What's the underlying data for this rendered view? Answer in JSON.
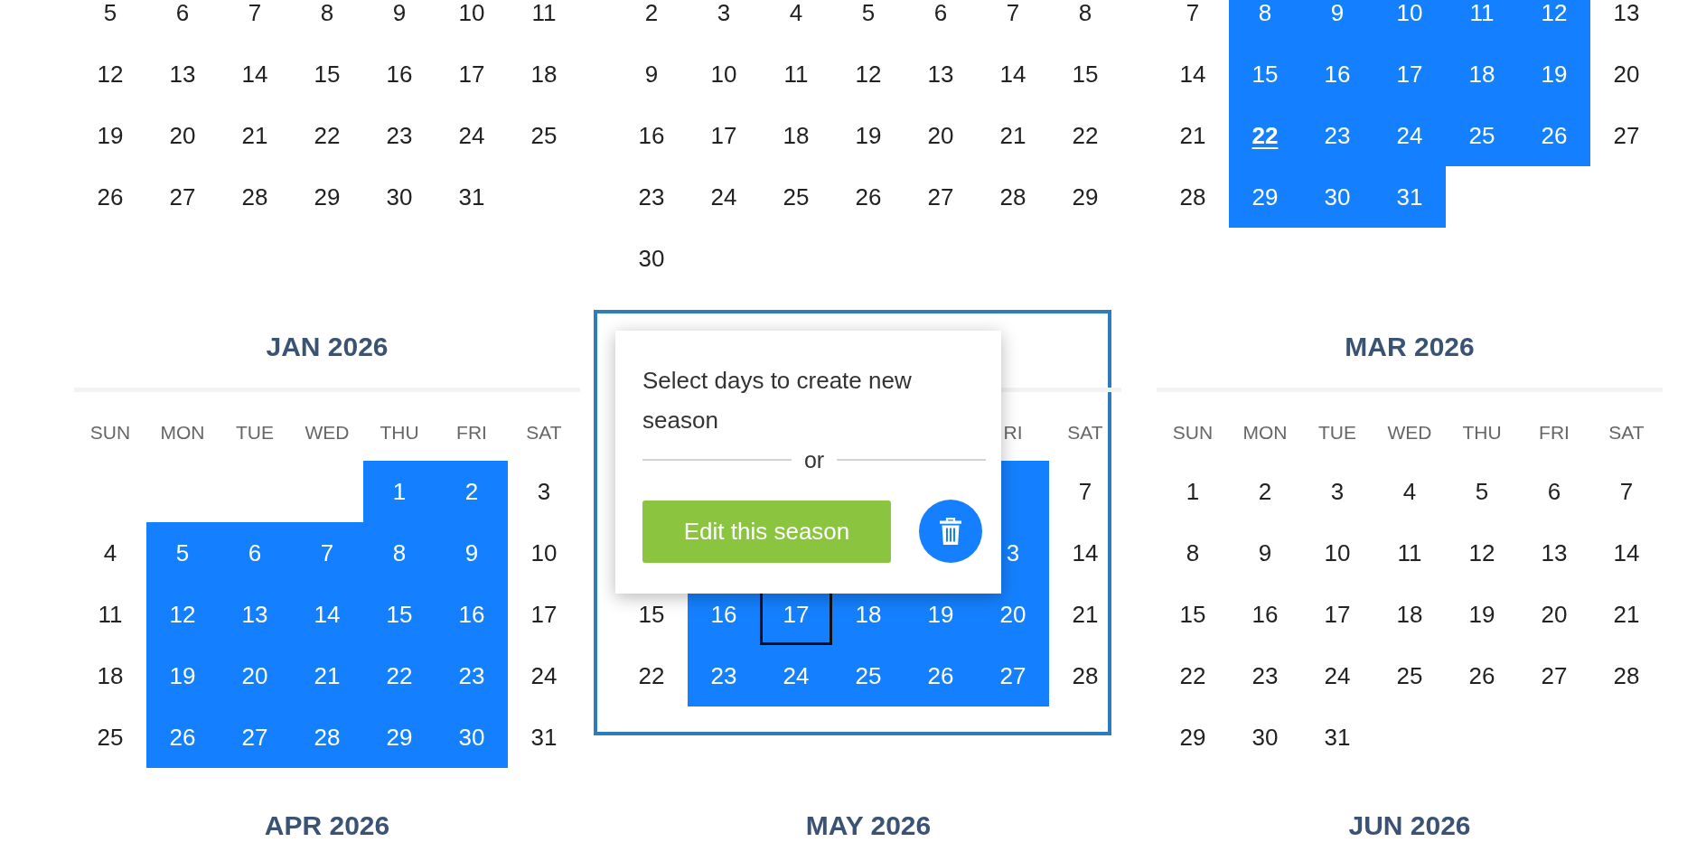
{
  "rows": [
    {
      "months": [
        {
          "highlighted": false,
          "weeks": [
            [
              {
                "day": "5",
                "selected": false,
                "today": false,
                "focused": false
              },
              {
                "day": "6",
                "selected": false,
                "today": false,
                "focused": false
              },
              {
                "day": "7",
                "selected": false,
                "today": false,
                "focused": false
              },
              {
                "day": "8",
                "selected": false,
                "today": false,
                "focused": false
              },
              {
                "day": "9",
                "selected": false,
                "today": false,
                "focused": false
              },
              {
                "day": "10",
                "selected": false,
                "today": false,
                "focused": false
              },
              {
                "day": "11",
                "selected": false,
                "today": false,
                "focused": false
              }
            ],
            [
              {
                "day": "12",
                "selected": false,
                "today": false,
                "focused": false
              },
              {
                "day": "13",
                "selected": false,
                "today": false,
                "focused": false
              },
              {
                "day": "14",
                "selected": false,
                "today": false,
                "focused": false
              },
              {
                "day": "15",
                "selected": false,
                "today": false,
                "focused": false
              },
              {
                "day": "16",
                "selected": false,
                "today": false,
                "focused": false
              },
              {
                "day": "17",
                "selected": false,
                "today": false,
                "focused": false
              },
              {
                "day": "18",
                "selected": false,
                "today": false,
                "focused": false
              }
            ],
            [
              {
                "day": "19",
                "selected": false,
                "today": false,
                "focused": false
              },
              {
                "day": "20",
                "selected": false,
                "today": false,
                "focused": false
              },
              {
                "day": "21",
                "selected": false,
                "today": false,
                "focused": false
              },
              {
                "day": "22",
                "selected": false,
                "today": false,
                "focused": false
              },
              {
                "day": "23",
                "selected": false,
                "today": false,
                "focused": false
              },
              {
                "day": "24",
                "selected": false,
                "today": false,
                "focused": false
              },
              {
                "day": "25",
                "selected": false,
                "today": false,
                "focused": false
              }
            ],
            [
              {
                "day": "26",
                "selected": false,
                "today": false,
                "focused": false
              },
              {
                "day": "27",
                "selected": false,
                "today": false,
                "focused": false
              },
              {
                "day": "28",
                "selected": false,
                "today": false,
                "focused": false
              },
              {
                "day": "29",
                "selected": false,
                "today": false,
                "focused": false
              },
              {
                "day": "30",
                "selected": false,
                "today": false,
                "focused": false
              },
              {
                "day": "31",
                "selected": false,
                "today": false,
                "focused": false
              }
            ]
          ]
        },
        {
          "highlighted": false,
          "weeks": [
            [
              {
                "day": "2",
                "selected": false,
                "today": false,
                "focused": false
              },
              {
                "day": "3",
                "selected": false,
                "today": false,
                "focused": false
              },
              {
                "day": "4",
                "selected": false,
                "today": false,
                "focused": false
              },
              {
                "day": "5",
                "selected": false,
                "today": false,
                "focused": false
              },
              {
                "day": "6",
                "selected": false,
                "today": false,
                "focused": false
              },
              {
                "day": "7",
                "selected": false,
                "today": false,
                "focused": false
              },
              {
                "day": "8",
                "selected": false,
                "today": false,
                "focused": false
              }
            ],
            [
              {
                "day": "9",
                "selected": false,
                "today": false,
                "focused": false
              },
              {
                "day": "10",
                "selected": false,
                "today": false,
                "focused": false
              },
              {
                "day": "11",
                "selected": false,
                "today": false,
                "focused": false
              },
              {
                "day": "12",
                "selected": false,
                "today": false,
                "focused": false
              },
              {
                "day": "13",
                "selected": false,
                "today": false,
                "focused": false
              },
              {
                "day": "14",
                "selected": false,
                "today": false,
                "focused": false
              },
              {
                "day": "15",
                "selected": false,
                "today": false,
                "focused": false
              }
            ],
            [
              {
                "day": "16",
                "selected": false,
                "today": false,
                "focused": false
              },
              {
                "day": "17",
                "selected": false,
                "today": false,
                "focused": false
              },
              {
                "day": "18",
                "selected": false,
                "today": false,
                "focused": false
              },
              {
                "day": "19",
                "selected": false,
                "today": false,
                "focused": false
              },
              {
                "day": "20",
                "selected": false,
                "today": false,
                "focused": false
              },
              {
                "day": "21",
                "selected": false,
                "today": false,
                "focused": false
              },
              {
                "day": "22",
                "selected": false,
                "today": false,
                "focused": false
              }
            ],
            [
              {
                "day": "23",
                "selected": false,
                "today": false,
                "focused": false
              },
              {
                "day": "24",
                "selected": false,
                "today": false,
                "focused": false
              },
              {
                "day": "25",
                "selected": false,
                "today": false,
                "focused": false
              },
              {
                "day": "26",
                "selected": false,
                "today": false,
                "focused": false
              },
              {
                "day": "27",
                "selected": false,
                "today": false,
                "focused": false
              },
              {
                "day": "28",
                "selected": false,
                "today": false,
                "focused": false
              },
              {
                "day": "29",
                "selected": false,
                "today": false,
                "focused": false
              }
            ],
            [
              {
                "day": "30",
                "selected": false,
                "today": false,
                "focused": false
              }
            ]
          ]
        },
        {
          "highlighted": false,
          "weeks": [
            [
              {
                "day": "7",
                "selected": false,
                "today": false,
                "focused": false
              },
              {
                "day": "8",
                "selected": true,
                "today": false,
                "focused": false
              },
              {
                "day": "9",
                "selected": true,
                "today": false,
                "focused": false
              },
              {
                "day": "10",
                "selected": true,
                "today": false,
                "focused": false
              },
              {
                "day": "11",
                "selected": true,
                "today": false,
                "focused": false
              },
              {
                "day": "12",
                "selected": true,
                "today": false,
                "focused": false
              },
              {
                "day": "13",
                "selected": false,
                "today": false,
                "focused": false
              }
            ],
            [
              {
                "day": "14",
                "selected": false,
                "today": false,
                "focused": false
              },
              {
                "day": "15",
                "selected": true,
                "today": false,
                "focused": false
              },
              {
                "day": "16",
                "selected": true,
                "today": false,
                "focused": false
              },
              {
                "day": "17",
                "selected": true,
                "today": false,
                "focused": false
              },
              {
                "day": "18",
                "selected": true,
                "today": false,
                "focused": false
              },
              {
                "day": "19",
                "selected": true,
                "today": false,
                "focused": false
              },
              {
                "day": "20",
                "selected": false,
                "today": false,
                "focused": false
              }
            ],
            [
              {
                "day": "21",
                "selected": false,
                "today": false,
                "focused": false
              },
              {
                "day": "22",
                "selected": true,
                "today": true,
                "focused": false
              },
              {
                "day": "23",
                "selected": true,
                "today": false,
                "focused": false
              },
              {
                "day": "24",
                "selected": true,
                "today": false,
                "focused": false
              },
              {
                "day": "25",
                "selected": true,
                "today": false,
                "focused": false
              },
              {
                "day": "26",
                "selected": true,
                "today": false,
                "focused": false
              },
              {
                "day": "27",
                "selected": false,
                "today": false,
                "focused": false
              }
            ],
            [
              {
                "day": "28",
                "selected": false,
                "today": false,
                "focused": false
              },
              {
                "day": "29",
                "selected": true,
                "today": false,
                "focused": false
              },
              {
                "day": "30",
                "selected": true,
                "today": false,
                "focused": false
              },
              {
                "day": "31",
                "selected": true,
                "today": false,
                "focused": false
              }
            ]
          ]
        }
      ]
    },
    {
      "months": [
        {
          "title": "JAN 2026",
          "highlighted": false,
          "weekdays": [
            "SUN",
            "MON",
            "TUE",
            "WED",
            "THU",
            "FRI",
            "SAT"
          ],
          "weeks": [
            [
              {
                "day": "1",
                "selected": true,
                "today": false,
                "focused": false
              },
              {
                "day": "2",
                "selected": true,
                "today": false,
                "focused": false
              },
              {
                "day": "3",
                "selected": false,
                "today": false,
                "focused": false
              }
            ],
            [
              {
                "day": "4",
                "selected": false,
                "today": false,
                "focused": false
              },
              {
                "day": "5",
                "selected": true,
                "today": false,
                "focused": false
              },
              {
                "day": "6",
                "selected": true,
                "today": false,
                "focused": false
              },
              {
                "day": "7",
                "selected": true,
                "today": false,
                "focused": false
              },
              {
                "day": "8",
                "selected": true,
                "today": false,
                "focused": false
              },
              {
                "day": "9",
                "selected": true,
                "today": false,
                "focused": false
              },
              {
                "day": "10",
                "selected": false,
                "today": false,
                "focused": false
              }
            ],
            [
              {
                "day": "11",
                "selected": false,
                "today": false,
                "focused": false
              },
              {
                "day": "12",
                "selected": true,
                "today": false,
                "focused": false
              },
              {
                "day": "13",
                "selected": true,
                "today": false,
                "focused": false
              },
              {
                "day": "14",
                "selected": true,
                "today": false,
                "focused": false
              },
              {
                "day": "15",
                "selected": true,
                "today": false,
                "focused": false
              },
              {
                "day": "16",
                "selected": true,
                "today": false,
                "focused": false
              },
              {
                "day": "17",
                "selected": false,
                "today": false,
                "focused": false
              }
            ],
            [
              {
                "day": "18",
                "selected": false,
                "today": false,
                "focused": false
              },
              {
                "day": "19",
                "selected": true,
                "today": false,
                "focused": false
              },
              {
                "day": "20",
                "selected": true,
                "today": false,
                "focused": false
              },
              {
                "day": "21",
                "selected": true,
                "today": false,
                "focused": false
              },
              {
                "day": "22",
                "selected": true,
                "today": false,
                "focused": false
              },
              {
                "day": "23",
                "selected": true,
                "today": false,
                "focused": false
              },
              {
                "day": "24",
                "selected": false,
                "today": false,
                "focused": false
              }
            ],
            [
              {
                "day": "25",
                "selected": false,
                "today": false,
                "focused": false
              },
              {
                "day": "26",
                "selected": true,
                "today": false,
                "focused": false
              },
              {
                "day": "27",
                "selected": true,
                "today": false,
                "focused": false
              },
              {
                "day": "28",
                "selected": true,
                "today": false,
                "focused": false
              },
              {
                "day": "29",
                "selected": true,
                "today": false,
                "focused": false
              },
              {
                "day": "30",
                "selected": true,
                "today": false,
                "focused": false
              },
              {
                "day": "31",
                "selected": false,
                "today": false,
                "focused": false
              }
            ]
          ]
        },
        {
          "highlighted": true,
          "weekdays": [
            "RI",
            "SAT"
          ],
          "weeks": [
            [
              {
                "selected": true,
                "today": false,
                "focused": false
              },
              {
                "day": "7",
                "selected": false,
                "today": false,
                "focused": false
              }
            ],
            [
              {
                "day": "3",
                "selected": true,
                "today": false,
                "focused": false
              },
              {
                "day": "14",
                "selected": false,
                "today": false,
                "focused": false
              }
            ],
            [
              {
                "day": "15",
                "selected": false,
                "today": false,
                "focused": false
              },
              {
                "day": "16",
                "selected": true,
                "today": false,
                "focused": false
              },
              {
                "day": "17",
                "selected": true,
                "today": false,
                "focused": true
              },
              {
                "day": "18",
                "selected": true,
                "today": false,
                "focused": false
              },
              {
                "day": "19",
                "selected": true,
                "today": false,
                "focused": false
              },
              {
                "day": "20",
                "selected": true,
                "today": false,
                "focused": false
              },
              {
                "day": "21",
                "selected": false,
                "today": false,
                "focused": false
              }
            ],
            [
              {
                "day": "22",
                "selected": false,
                "today": false,
                "focused": false
              },
              {
                "day": "23",
                "selected": true,
                "today": false,
                "focused": false
              },
              {
                "day": "24",
                "selected": true,
                "today": false,
                "focused": false
              },
              {
                "day": "25",
                "selected": true,
                "today": false,
                "focused": false
              },
              {
                "day": "26",
                "selected": true,
                "today": false,
                "focused": false
              },
              {
                "day": "27",
                "selected": true,
                "today": false,
                "focused": false
              },
              {
                "day": "28",
                "selected": false,
                "today": false,
                "focused": false
              }
            ]
          ],
          "popup": {
            "message": "Select days to create new season",
            "separator": "or",
            "edit_button": "Edit this season"
          }
        },
        {
          "title": "MAR 2026",
          "highlighted": false,
          "weekdays": [
            "SUN",
            "MON",
            "TUE",
            "WED",
            "THU",
            "FRI",
            "SAT"
          ],
          "weeks": [
            [
              {
                "day": "1",
                "selected": false,
                "today": false,
                "focused": false
              },
              {
                "day": "2",
                "selected": false,
                "today": false,
                "focused": false
              },
              {
                "day": "3",
                "selected": false,
                "today": false,
                "focused": false
              },
              {
                "day": "4",
                "selected": false,
                "today": false,
                "focused": false
              },
              {
                "day": "5",
                "selected": false,
                "today": false,
                "focused": false
              },
              {
                "day": "6",
                "selected": false,
                "today": false,
                "focused": false
              },
              {
                "day": "7",
                "selected": false,
                "today": false,
                "focused": false
              }
            ],
            [
              {
                "day": "8",
                "selected": false,
                "today": false,
                "focused": false
              },
              {
                "day": "9",
                "selected": false,
                "today": false,
                "focused": false
              },
              {
                "day": "10",
                "selected": false,
                "today": false,
                "focused": false
              },
              {
                "day": "11",
                "selected": false,
                "today": false,
                "focused": false
              },
              {
                "day": "12",
                "selected": false,
                "today": false,
                "focused": false
              },
              {
                "day": "13",
                "selected": false,
                "today": false,
                "focused": false
              },
              {
                "day": "14",
                "selected": false,
                "today": false,
                "focused": false
              }
            ],
            [
              {
                "day": "15",
                "selected": false,
                "today": false,
                "focused": false
              },
              {
                "day": "16",
                "selected": false,
                "today": false,
                "focused": false
              },
              {
                "day": "17",
                "selected": false,
                "today": false,
                "focused": false
              },
              {
                "day": "18",
                "selected": false,
                "today": false,
                "focused": false
              },
              {
                "day": "19",
                "selected": false,
                "today": false,
                "focused": false
              },
              {
                "day": "20",
                "selected": false,
                "today": false,
                "focused": false
              },
              {
                "day": "21",
                "selected": false,
                "today": false,
                "focused": false
              }
            ],
            [
              {
                "day": "22",
                "selected": false,
                "today": false,
                "focused": false
              },
              {
                "day": "23",
                "selected": false,
                "today": false,
                "focused": false
              },
              {
                "day": "24",
                "selected": false,
                "today": false,
                "focused": false
              },
              {
                "day": "25",
                "selected": false,
                "today": false,
                "focused": false
              },
              {
                "day": "26",
                "selected": false,
                "today": false,
                "focused": false
              },
              {
                "day": "27",
                "selected": false,
                "today": false,
                "focused": false
              },
              {
                "day": "28",
                "selected": false,
                "today": false,
                "focused": false
              }
            ],
            [
              {
                "day": "29",
                "selected": false,
                "today": false,
                "focused": false
              },
              {
                "day": "30",
                "selected": false,
                "today": false,
                "focused": false
              },
              {
                "day": "31",
                "selected": false,
                "today": false,
                "focused": false
              }
            ]
          ]
        }
      ]
    },
    {
      "months": [
        {
          "title": "APR 2026",
          "highlighted": false
        },
        {
          "title": "MAY 2026",
          "highlighted": false
        },
        {
          "title": "JUN 2026",
          "highlighted": false
        }
      ]
    }
  ]
}
